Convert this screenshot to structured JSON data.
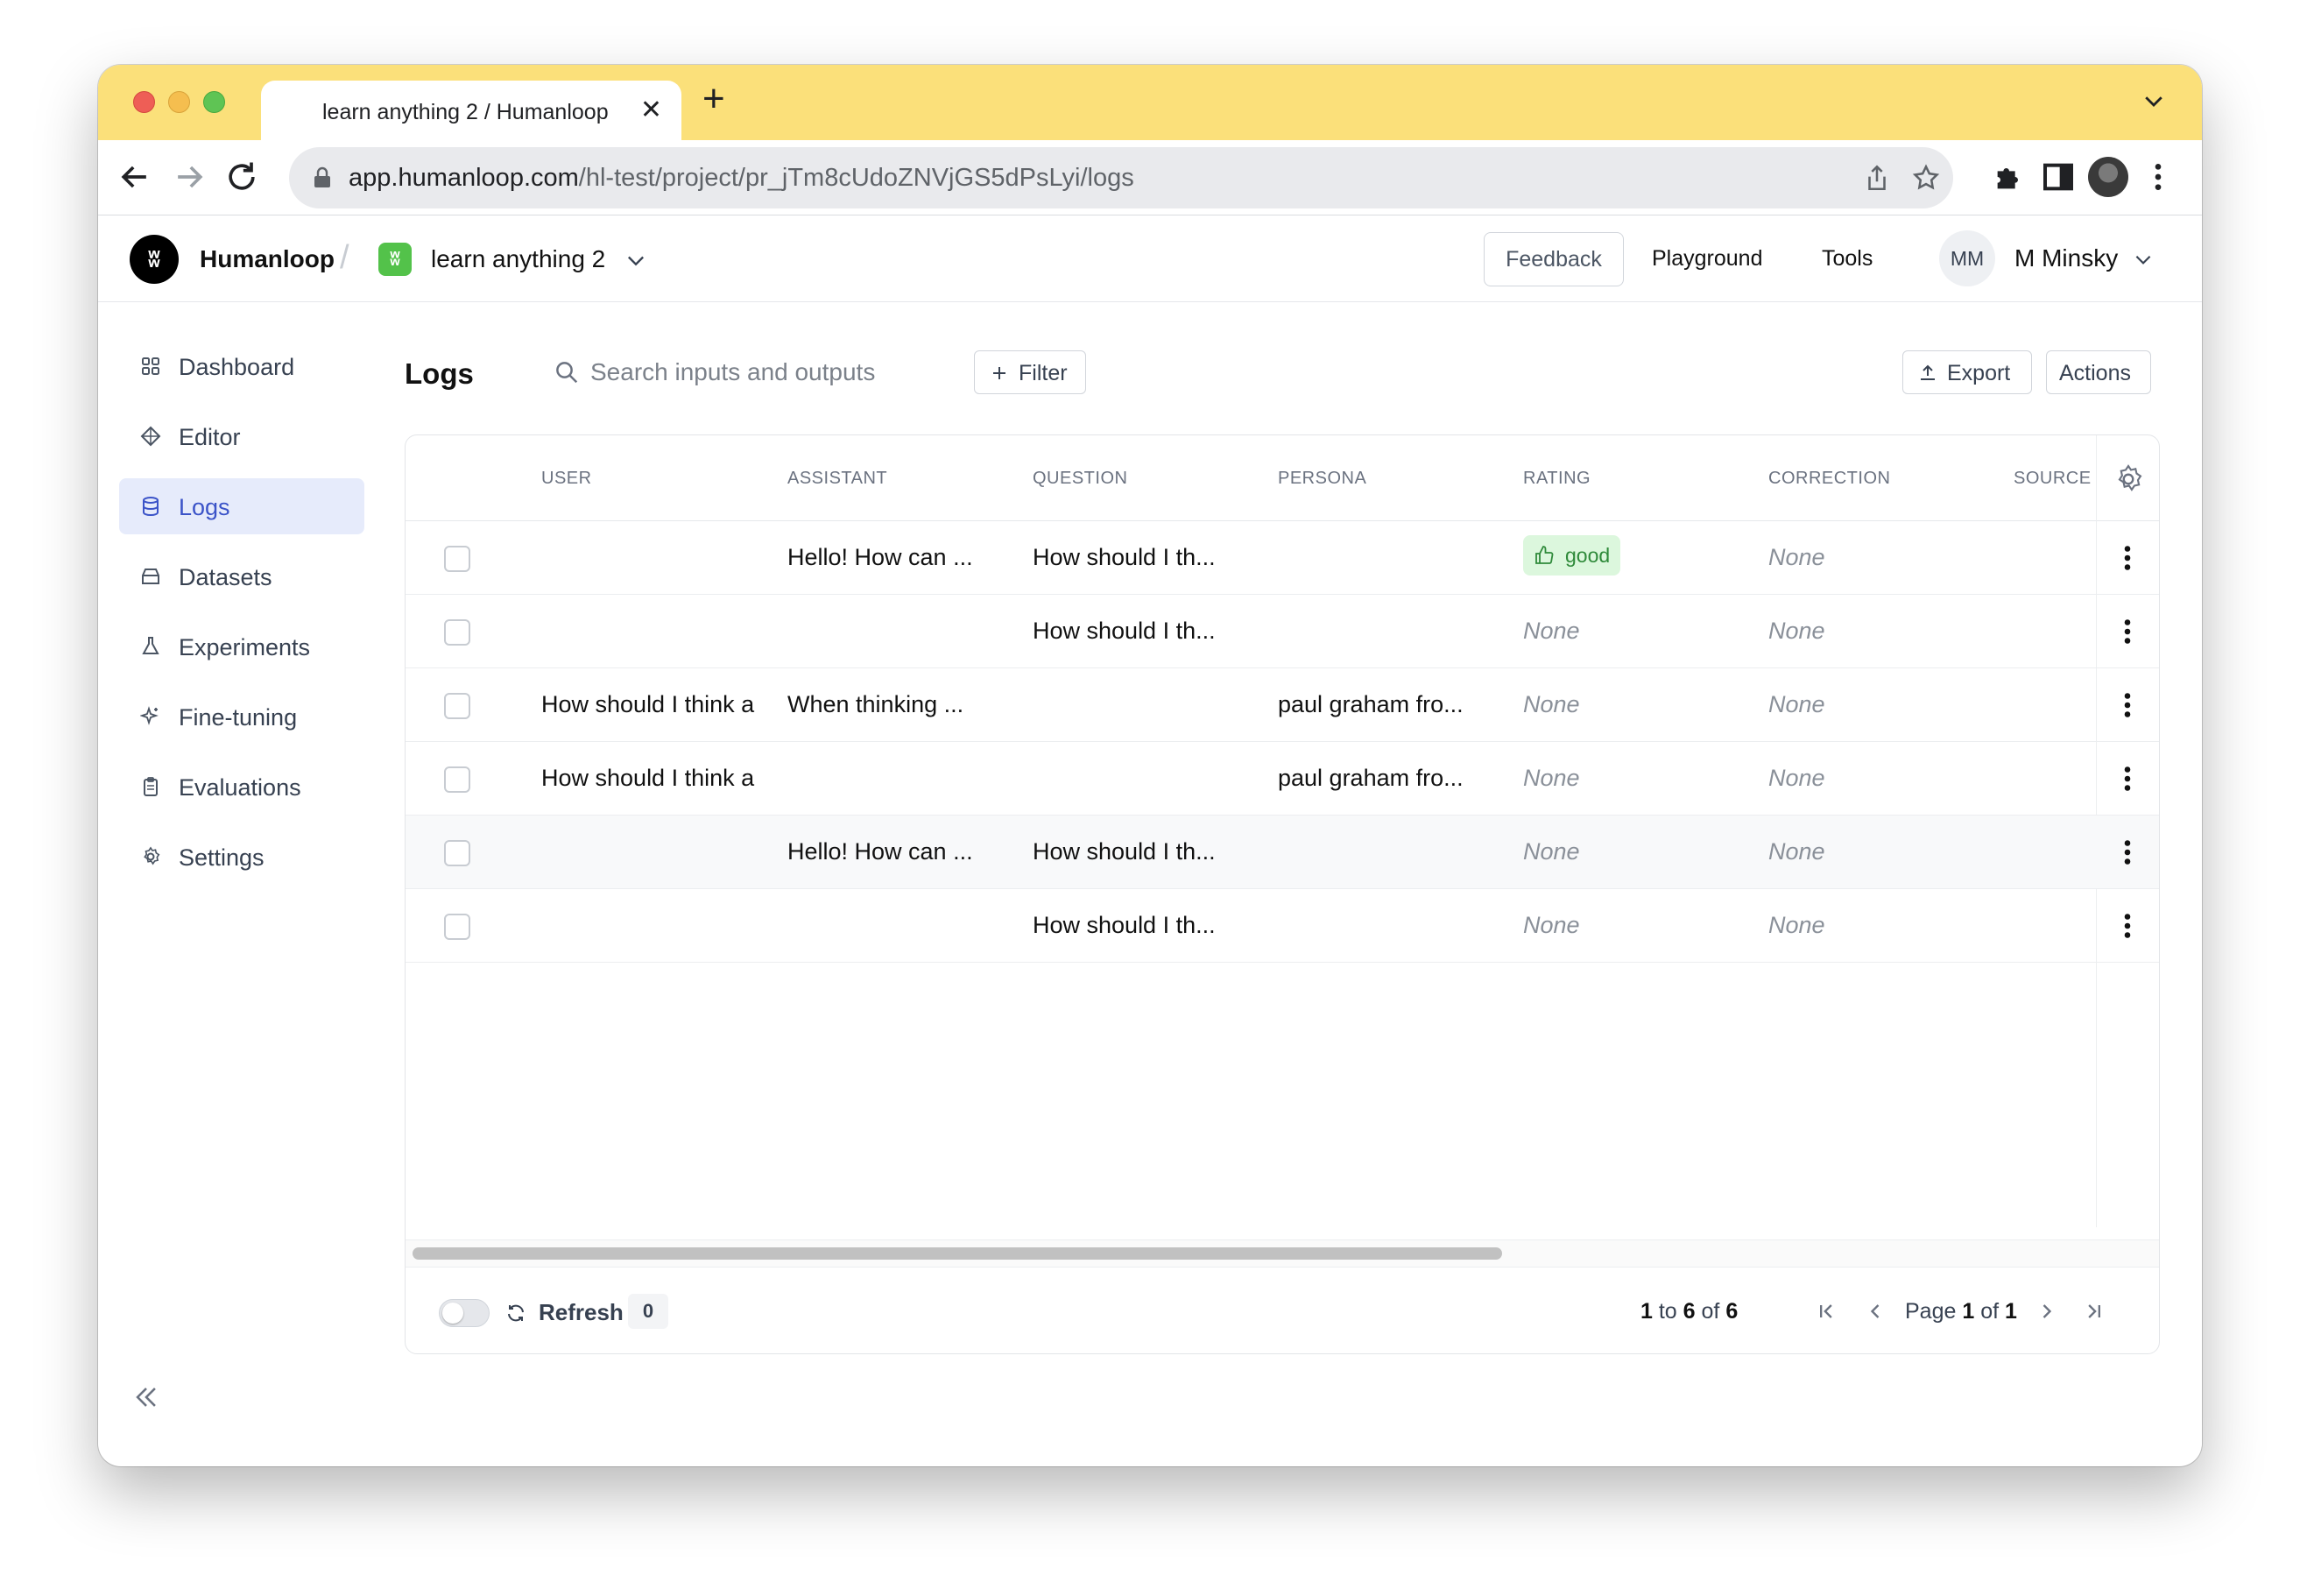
{
  "browser": {
    "tab_title": "learn anything 2 / Humanloop",
    "url_host": "app.humanloop.com",
    "url_path": "/hl-test/project/pr_jTm8cUdoZNVjGS5dPsLyi/logs"
  },
  "header": {
    "brand": "Humanloop",
    "logo_glyph": "ʬ",
    "project_glyph": "ʬ",
    "project_name": "learn anything 2",
    "feedback_label": "Feedback",
    "playground_label": "Playground",
    "tools_label": "Tools",
    "user_initials": "MM",
    "user_name": "M Minsky"
  },
  "sidebar": {
    "items": [
      {
        "label": "Dashboard",
        "icon": "grid-icon"
      },
      {
        "label": "Editor",
        "icon": "diamond-icon"
      },
      {
        "label": "Logs",
        "icon": "database-icon",
        "active": true
      },
      {
        "label": "Datasets",
        "icon": "archive-icon"
      },
      {
        "label": "Experiments",
        "icon": "flask-icon"
      },
      {
        "label": "Fine-tuning",
        "icon": "sparkle-icon"
      },
      {
        "label": "Evaluations",
        "icon": "clipboard-icon"
      },
      {
        "label": "Settings",
        "icon": "gear-icon"
      }
    ]
  },
  "main": {
    "title": "Logs",
    "search_placeholder": "Search inputs and outputs",
    "filter_label": "Filter",
    "export_label": "Export",
    "actions_label": "Actions"
  },
  "table": {
    "columns": [
      "USER",
      "ASSISTANT",
      "QUESTION",
      "PERSONA",
      "RATING",
      "CORRECTION",
      "SOURCE"
    ],
    "rows": [
      {
        "user": "",
        "assistant": "Hello! How can ...",
        "question": "How should I th...",
        "persona": "",
        "rating": "good",
        "correction": "None"
      },
      {
        "user": "",
        "assistant": "",
        "question": "How should I th...",
        "persona": "",
        "rating": "None",
        "correction": "None"
      },
      {
        "user": "How should I think a",
        "assistant": "When thinking ...",
        "question": "",
        "persona": "paul graham fro...",
        "rating": "None",
        "correction": "None"
      },
      {
        "user": "How should I think a",
        "assistant": "",
        "question": "",
        "persona": "paul graham fro...",
        "rating": "None",
        "correction": "None"
      },
      {
        "user": "",
        "assistant": "Hello! How can ...",
        "question": "How should I th...",
        "persona": "",
        "rating": "None",
        "correction": "None"
      },
      {
        "user": "",
        "assistant": "",
        "question": "How should I th...",
        "persona": "",
        "rating": "None",
        "correction": "None"
      }
    ]
  },
  "footer": {
    "refresh_label": "Refresh",
    "refresh_count": "0",
    "rows_from": "1",
    "rows_to": "6",
    "rows_total": "6",
    "rows_to_word": "to",
    "rows_of_word": "of",
    "page_word": "Page",
    "page_current": "1",
    "page_of_word": "of",
    "page_total": "1"
  },
  "colors": {
    "tabbar": "#fbe07a",
    "active_nav_bg": "#e6ebfb",
    "active_nav_text": "#3b53c8",
    "rating_good_bg": "#dcf7dd",
    "rating_good_text": "#2f8a3a",
    "project_logo": "#53c24a"
  }
}
